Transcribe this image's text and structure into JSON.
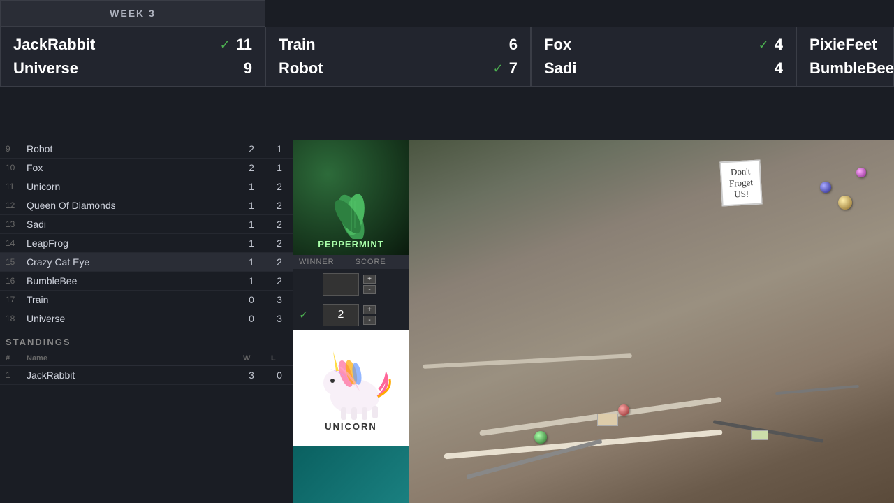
{
  "header": {
    "week_label": "WEEK 3"
  },
  "match_cards": [
    {
      "id": "card1",
      "rows": [
        {
          "team": "JackRabbit",
          "score": "11",
          "has_check": true
        },
        {
          "team": "Universe",
          "score": "9",
          "has_check": false
        }
      ]
    },
    {
      "id": "card2",
      "rows": [
        {
          "team": "Train",
          "score": "6",
          "has_check": false
        },
        {
          "team": "Robot",
          "score": "7",
          "has_check": true
        }
      ]
    },
    {
      "id": "card3",
      "rows": [
        {
          "team": "Fox",
          "score": "4",
          "has_check": true
        },
        {
          "team": "Sadi",
          "score": "4",
          "has_check": false
        }
      ]
    },
    {
      "id": "card4",
      "rows": [
        {
          "team": "PixieFeet",
          "score": "",
          "has_check": false
        },
        {
          "team": "BumbleBee",
          "score": "",
          "has_check": false
        }
      ]
    }
  ],
  "match_list": {
    "items": [
      {
        "num": 9,
        "name": "Robot",
        "w": 2,
        "l": 1
      },
      {
        "num": 10,
        "name": "Fox",
        "w": 2,
        "l": 1
      },
      {
        "num": 11,
        "name": "Unicorn",
        "w": 1,
        "l": 2
      },
      {
        "num": 12,
        "name": "Queen Of Diamonds",
        "w": 1,
        "l": 2
      },
      {
        "num": 13,
        "name": "Sadi",
        "w": 1,
        "l": 2
      },
      {
        "num": 14,
        "name": "LeapFrog",
        "w": 1,
        "l": 2
      },
      {
        "num": 15,
        "name": "Crazy Cat Eye",
        "w": 1,
        "l": 2,
        "active": true
      },
      {
        "num": 16,
        "name": "BumbleBee",
        "w": 1,
        "l": 2
      },
      {
        "num": 17,
        "name": "Train",
        "w": 0,
        "l": 3
      },
      {
        "num": 18,
        "name": "Universe",
        "w": 0,
        "l": 3
      }
    ]
  },
  "standings": {
    "title": "STANDINGS",
    "columns": {
      "num": "#",
      "name": "Name",
      "w": "W",
      "l": "L"
    },
    "items": [
      {
        "num": 1,
        "name": "JackRabbit",
        "w": 3,
        "l": 0
      }
    ]
  },
  "center_panel": {
    "peppermint_name": "PEPPERMINT",
    "winner_label": "WINNER",
    "score_label": "SCORE",
    "score1": "",
    "score2": "2",
    "unicorn_label": "UNICORN"
  },
  "sign": {
    "line1": "Don't",
    "line2": "Froget",
    "line3": "US!"
  }
}
